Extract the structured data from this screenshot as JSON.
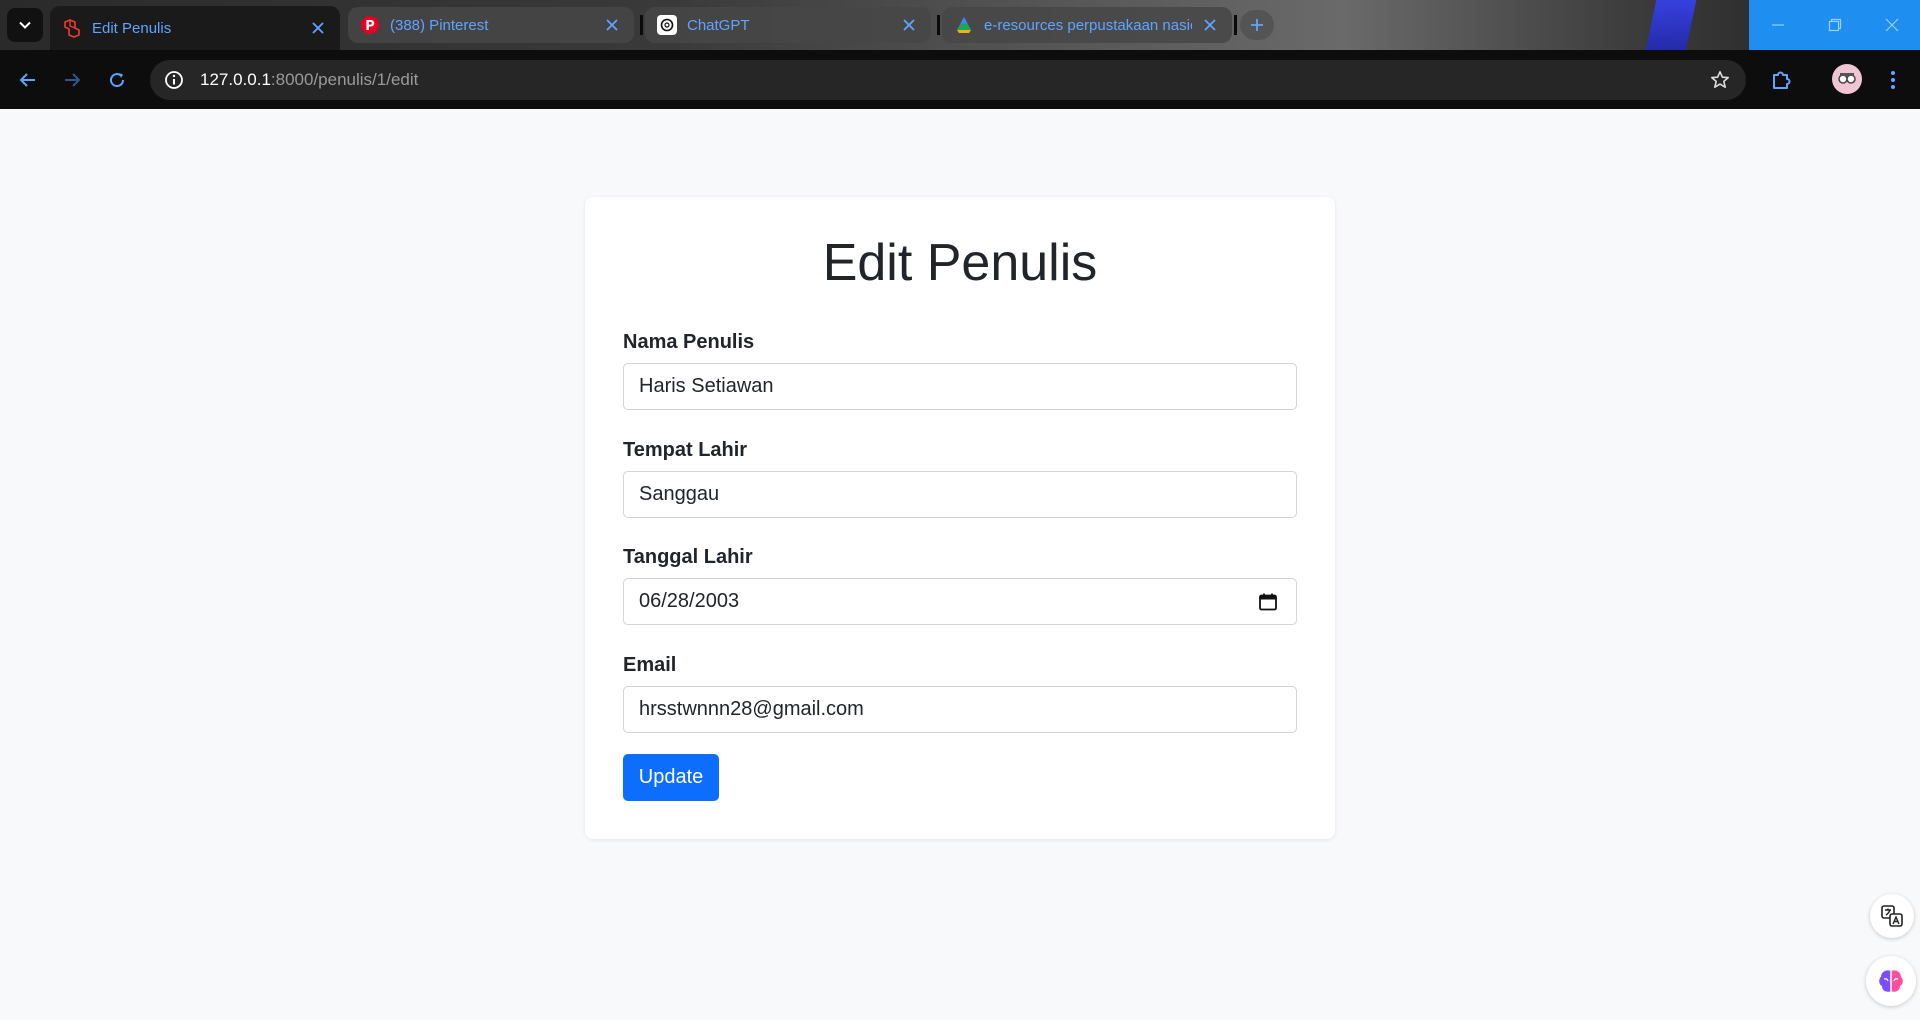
{
  "browser": {
    "tabs": [
      {
        "title": "Edit Penulis",
        "icon": "laravel-icon",
        "active": true
      },
      {
        "title": "(388) Pinterest",
        "icon": "pinterest-icon",
        "active": false
      },
      {
        "title": "ChatGPT",
        "icon": "chatgpt-icon",
        "active": false
      },
      {
        "title": "e-resources perpustakaan nasio",
        "icon": "drive-icon",
        "active": false
      }
    ],
    "address": {
      "host": "127.0.0.1",
      "rest": ":8000/penulis/1/edit"
    },
    "colors": {
      "tab_text": "#5fa4ff",
      "window_controls": "#1f8ef1"
    }
  },
  "form": {
    "title": "Edit Penulis",
    "fields": {
      "nama": {
        "label": "Nama Penulis",
        "value": "Haris Setiawan"
      },
      "tempat": {
        "label": "Tempat Lahir",
        "value": "Sanggau"
      },
      "tanggal": {
        "label": "Tanggal Lahir",
        "value": "06/28/2003"
      },
      "email": {
        "label": "Email",
        "value": "hrsstwnnn28@gmail.com"
      }
    },
    "submit_label": "Update",
    "colors": {
      "primary": "#0d6efd",
      "page_bg": "#f8f9fa"
    }
  }
}
